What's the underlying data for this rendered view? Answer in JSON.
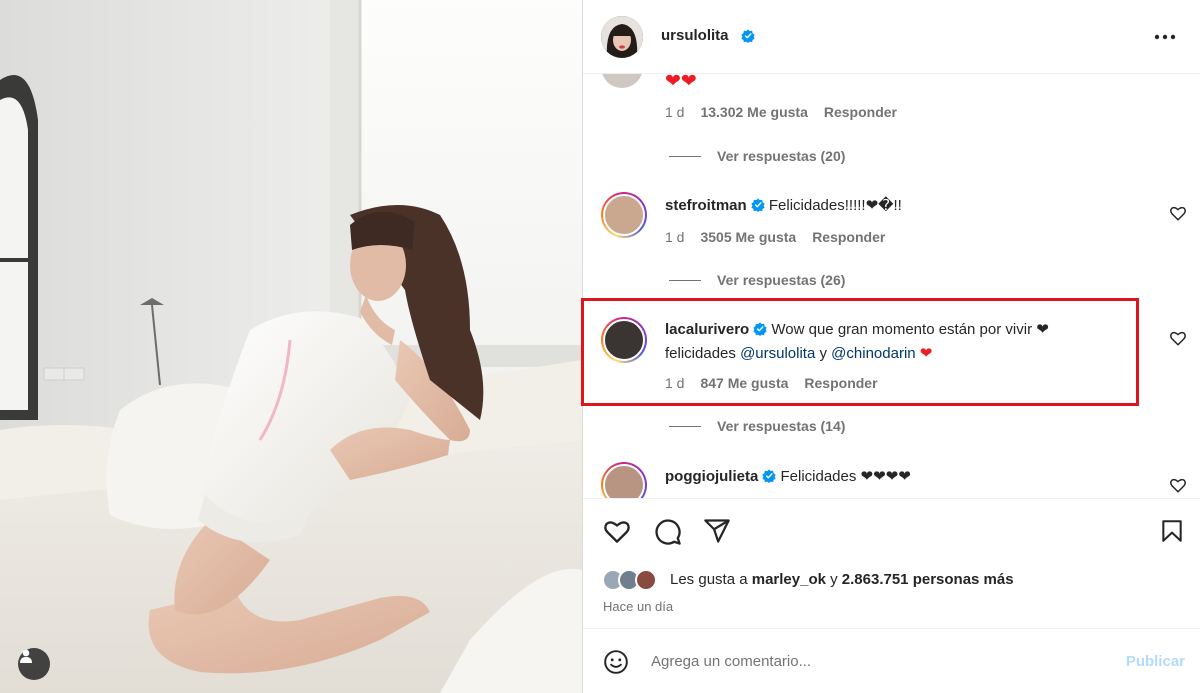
{
  "post": {
    "username": "ursulolita",
    "more_options_icon": "more-horizontal-icon"
  },
  "comments": [
    {
      "hearts": "❤❤",
      "time": "1 d",
      "likes": "13.302 Me gusta",
      "reply": "Responder",
      "view_replies": "Ver respuestas (20)"
    },
    {
      "username": "stefroitman",
      "text": "Felicidades!!!!!❤�!!",
      "time": "1 d",
      "likes": "3505 Me gusta",
      "reply": "Responder",
      "view_replies": "Ver respuestas (26)"
    },
    {
      "username": "lacalurivero",
      "text_line1": "Wow que gran momento están por vivir ❤",
      "text_line2_prefix": "felicidades",
      "mention1": "@ursulolita",
      "joiner": "y",
      "mention2": "@chinodarin",
      "heart": "❤",
      "time": "1 d",
      "likes": "847 Me gusta",
      "reply": "Responder",
      "view_replies": "Ver respuestas (14)"
    },
    {
      "username": "poggiojulieta",
      "text": "Felicidades ❤❤❤❤"
    }
  ],
  "actions": {
    "like_icon": "heart-outline-icon",
    "comment_icon": "comment-icon",
    "share_icon": "paper-plane-icon",
    "save_icon": "bookmark-icon",
    "liked_by_prefix": "Les gusta a",
    "liked_by_user": "marley_ok",
    "liked_by_joiner": "y",
    "liked_by_rest": "2.863.751 personas más",
    "time_ago": "Hace un día"
  },
  "add_comment": {
    "emoji_icon": "smiley-icon",
    "placeholder": "Agrega un comentario...",
    "post_label": "Publicar"
  },
  "colors": {
    "highlight": "#e0141e",
    "verified": "#0095f6",
    "heart": "#ed1c24",
    "mention": "#00376b",
    "post_disabled": "#b3dbff"
  }
}
